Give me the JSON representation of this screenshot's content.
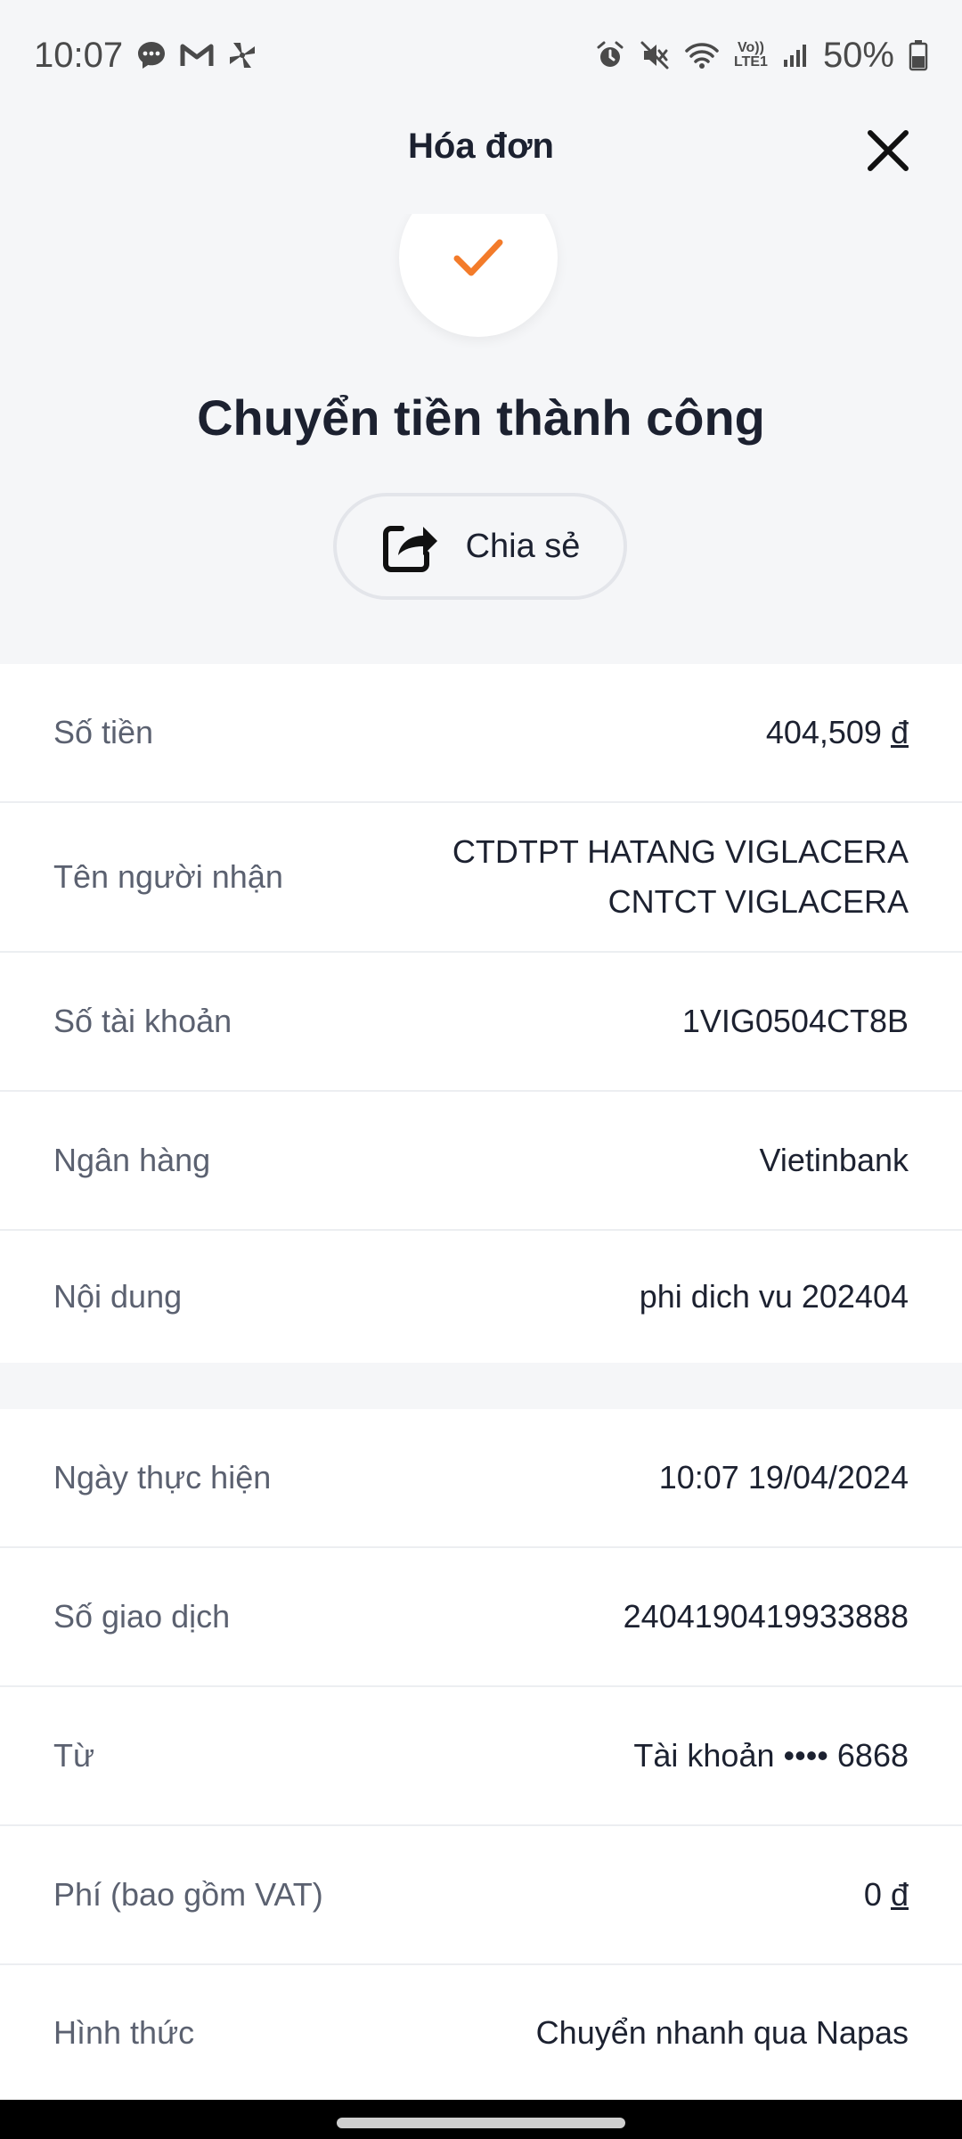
{
  "status_bar": {
    "time": "10:07",
    "battery": "50%",
    "lte_label_top": "Vo))",
    "lte_label_bottom": "LTE1",
    "left_icons": [
      "chat-bubble-icon",
      "gmail-icon",
      "pinwheel-icon"
    ],
    "right_icons": [
      "alarm-icon",
      "mute-icon",
      "wifi-icon",
      "lte-icon",
      "signal-icon",
      "battery-icon"
    ]
  },
  "header": {
    "title": "Hóa đơn",
    "close_icon": "close-icon"
  },
  "hero": {
    "check_icon": "checkmark-icon",
    "check_color": "#f37b2a",
    "title": "Chuyển tiền thành công",
    "share_label": "Chia sẻ",
    "share_icon": "share-icon"
  },
  "details": [
    {
      "label": "Số tiền",
      "value": "404,509",
      "currency": "đ"
    },
    {
      "label": "Tên người nhận",
      "value_line1": "CTDTPT HATANG VIGLACERA",
      "value_line2": "CNTCT VIGLACERA"
    },
    {
      "label": "Số tài khoản",
      "value": "1VIG0504CT8B"
    },
    {
      "label": "Ngân hàng",
      "value": "Vietinbank"
    },
    {
      "label": "Nội dung",
      "value": "phi dich vu 202404"
    }
  ],
  "transaction": [
    {
      "label": "Ngày thực hiện",
      "value": "10:07 19/04/2024"
    },
    {
      "label": "Số giao dịch",
      "value": "2404190419933888"
    },
    {
      "label": "Từ",
      "value": "Tài khoản •••• 6868"
    },
    {
      "label": "Phí (bao gồm VAT)",
      "value": "0",
      "currency": "đ"
    },
    {
      "label": "Hình thức",
      "value": "Chuyển nhanh qua Napas"
    }
  ]
}
